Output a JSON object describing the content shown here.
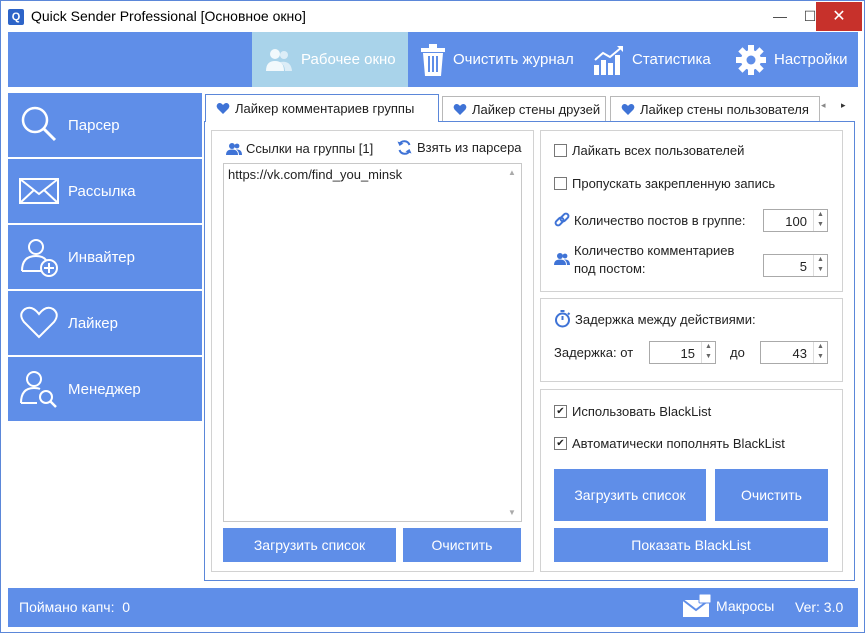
{
  "window": {
    "title": "Quick Sender Professional [Основное окно]",
    "logo_letter": "Q",
    "controls": {
      "minimize": "—",
      "maximize": "☐",
      "close": "✕"
    }
  },
  "topnav": {
    "items": [
      {
        "label": "Рабочее окно",
        "icon": "users-icon",
        "active": true
      },
      {
        "label": "Очистить журнал",
        "icon": "trash-icon",
        "active": false
      },
      {
        "label": "Статистика",
        "icon": "chart-icon",
        "active": false
      },
      {
        "label": "Настройки",
        "icon": "gear-icon",
        "active": false
      }
    ]
  },
  "sidebar": {
    "items": [
      {
        "label": "Парсер",
        "icon": "search-icon"
      },
      {
        "label": "Рассылка",
        "icon": "envelope-icon"
      },
      {
        "label": "Инвайтер",
        "icon": "add-user-icon"
      },
      {
        "label": "Лайкер",
        "icon": "heart-icon"
      },
      {
        "label": "Менеджер",
        "icon": "user-search-icon"
      }
    ]
  },
  "tabs": [
    {
      "label": "Лайкер комментариев группы",
      "active": true
    },
    {
      "label": "Лайкер стены друзей",
      "active": false
    },
    {
      "label": "Лайкер стены пользователя",
      "active": false
    }
  ],
  "tab_scroll": {
    "left": "◂",
    "right": "▸"
  },
  "groups": {
    "label": "Ссылки на группы [1]",
    "take_from_parser": "Взять из парсера",
    "text": "https://vk.com/find_you_minsk",
    "load_button": "Загрузить список",
    "clear_button": "Очистить"
  },
  "settings": {
    "like_all_users": {
      "label": "Лайкать всех пользователей",
      "checked": false
    },
    "skip_pinned": {
      "label": "Пропускать закрепленную запись",
      "checked": false
    },
    "posts_in_group": {
      "label": "Количество постов в группе:",
      "value": "100"
    },
    "comments_label_1": "Количество комментариев",
    "comments_label_2": "под постом:",
    "comments_value": "5"
  },
  "delay": {
    "title": "Задержка между действиями:",
    "from_label": "Задержка: от",
    "from_value": "15",
    "to_label": "до",
    "to_value": "43"
  },
  "blacklist": {
    "use": {
      "label": "Использовать BlackList",
      "checked": true
    },
    "auto_fill": {
      "label": "Автоматически пополнять BlackList",
      "checked": true
    },
    "load_button": "Загрузить список",
    "clear_button": "Очистить",
    "show_button": "Показать BlackList"
  },
  "statusbar": {
    "captcha_label": "Поймано капч:",
    "captcha_count": "0",
    "macros": "Макросы",
    "version": "Ver: 3.0"
  },
  "colors": {
    "accent": "#5f8ee8",
    "active_nav": "#a9d3ea",
    "close_button": "#c7312b"
  }
}
